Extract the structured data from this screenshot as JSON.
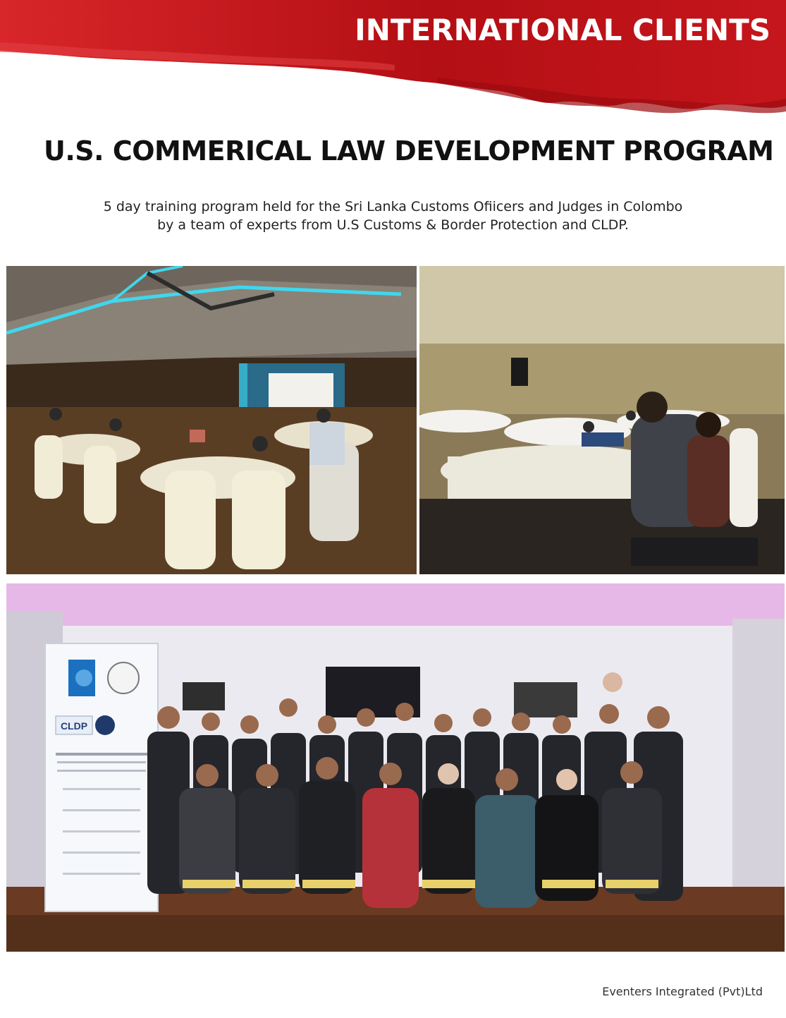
{
  "header": {
    "section_title": "INTERNATIONAL CLIENTS",
    "accent_color": "#c8151b"
  },
  "program": {
    "title": "U.S. COMMERICAL LAW DEVELOPMENT PROGRAM",
    "description_line1": "5 day training program held for the Sri Lanka Customs Ofiicers and Judges in Colombo",
    "description_line2": "by a team of experts from U.S Customs & Border Protection and CLDP."
  },
  "photos": {
    "banner_logo": "CLDP"
  },
  "footer": {
    "company": "Eventers Integrated (Pvt)Ltd"
  }
}
